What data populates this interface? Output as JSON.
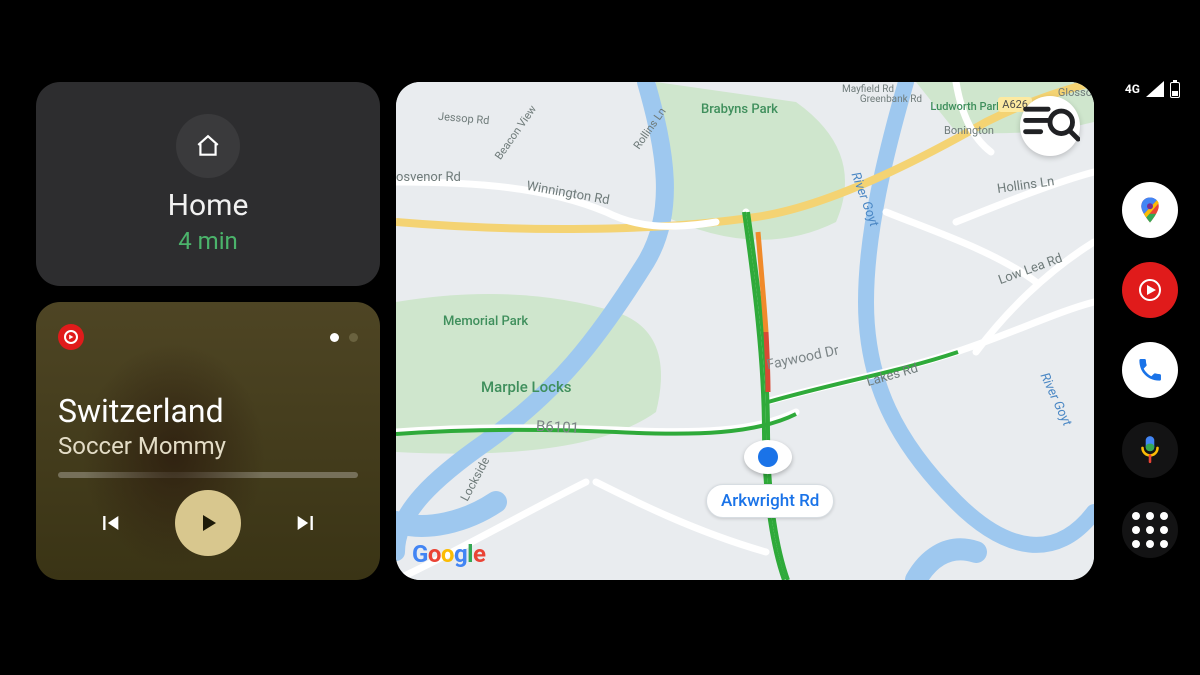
{
  "nav_card": {
    "destination": "Home",
    "eta": "4 min"
  },
  "media": {
    "app": "YouTube Music",
    "track_title": "Switzerland",
    "artist": "Soccer Mommy",
    "page_dots": {
      "count": 2,
      "active": 0
    }
  },
  "map": {
    "provider": "Google",
    "current_road": "Arkwright Rd",
    "roads": {
      "winnington": "Winnington Rd",
      "osvenor": "osvenor Rd",
      "hollins": "Hollins Ln",
      "lowlea": "Low Lea Rd",
      "lakes": "Lakes Rd",
      "faywood": "Faywood Dr",
      "b6101": "B6101",
      "lockside": "Lockside",
      "jessop": "Jessop Rd",
      "rollins": "Rollins Ln",
      "beacon": "Beacon View",
      "a626": "A626",
      "mayfield": "Mayfield Rd",
      "greenbank": "Greenbank Rd",
      "bonington": "Bonington",
      "glosso": "Glosso"
    },
    "parks": {
      "brabyns": "Brabyns Park",
      "memorial": "Memorial Park",
      "marple": "Marple Locks",
      "ludworth": "Ludworth Park"
    },
    "rivers": {
      "goyt": "River Goyt"
    }
  },
  "status_bar": {
    "network": "4G"
  },
  "rail": {
    "maps": "Google Maps",
    "music": "YouTube Music",
    "phone": "Phone",
    "assistant": "Assistant",
    "apps": "App grid"
  }
}
